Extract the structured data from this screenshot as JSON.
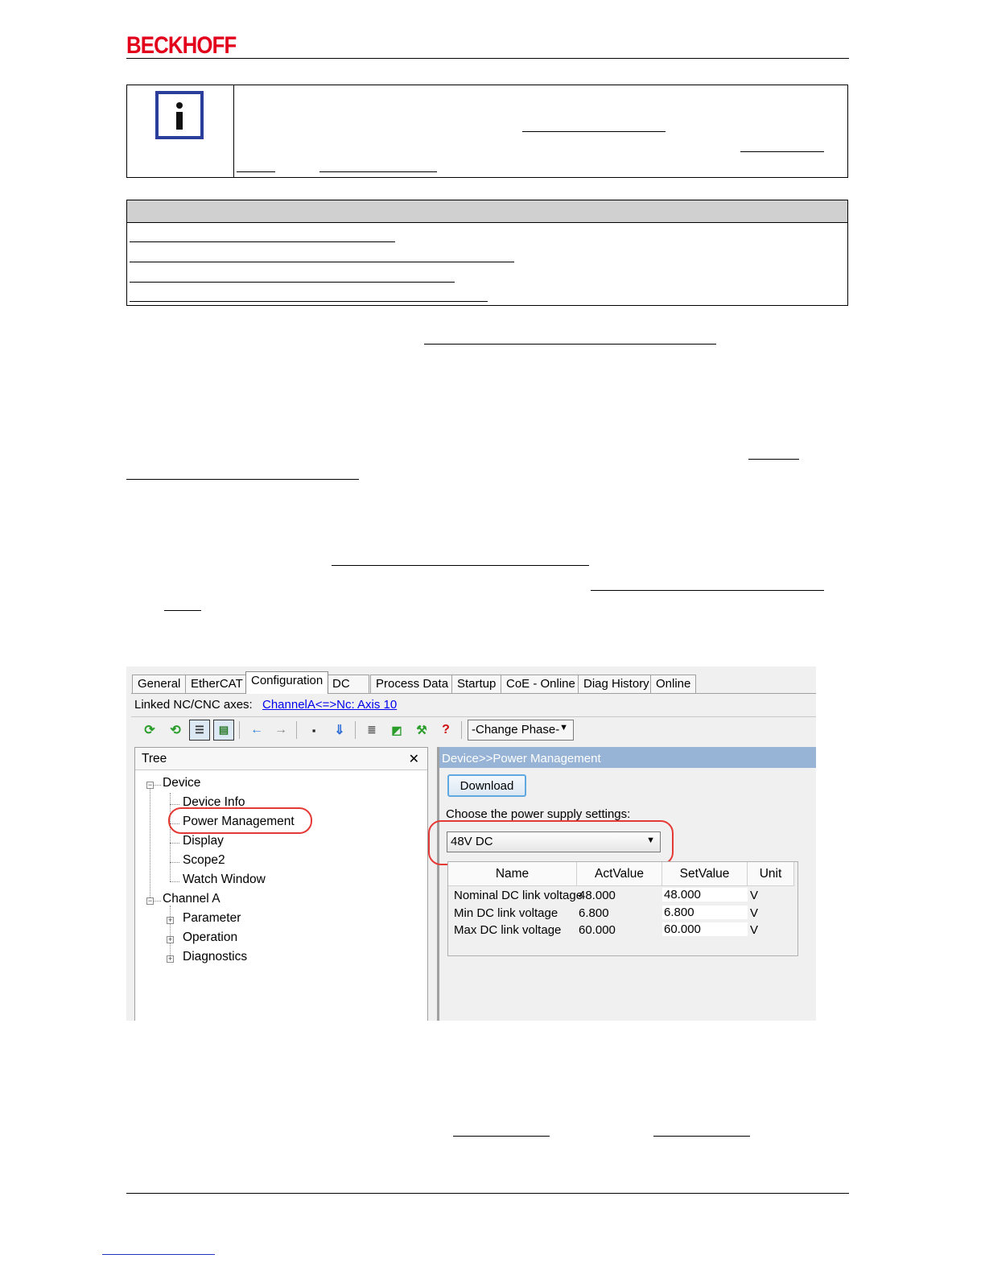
{
  "header": {
    "brand": "BECKHOFF"
  },
  "screenshot": {
    "tabs": [
      {
        "label": "General"
      },
      {
        "label": "EtherCAT"
      },
      {
        "label": "Configuration"
      },
      {
        "label": "DC"
      },
      {
        "label": "Process Data"
      },
      {
        "label": "Startup"
      },
      {
        "label": "CoE - Online"
      },
      {
        "label": "Diag History"
      },
      {
        "label": "Online"
      }
    ],
    "linked_axes": {
      "label": "Linked NC/CNC axes:",
      "link": "ChannelA<=>Nc: Axis 10"
    },
    "toolbar": {
      "phase_select": "-Change Phase-",
      "help_glyph": "?"
    },
    "tree": {
      "title": "Tree",
      "close_glyph": "✕",
      "items": [
        {
          "label": "Device"
        },
        {
          "label": "Device Info"
        },
        {
          "label": "Power Management"
        },
        {
          "label": "Display"
        },
        {
          "label": "Scope2"
        },
        {
          "label": "Watch Window"
        },
        {
          "label": "Channel A"
        },
        {
          "label": "Parameter"
        },
        {
          "label": "Operation"
        },
        {
          "label": "Diagnostics"
        }
      ]
    },
    "panel": {
      "title": "Device>>Power Management",
      "download_label": "Download",
      "choose_label": "Choose the power supply settings:",
      "supply_value": "48V DC",
      "columns": {
        "name": "Name",
        "act": "ActValue",
        "set": "SetValue",
        "unit": "Unit"
      },
      "rows": [
        {
          "name": "Nominal DC link voltage",
          "act": "48.000",
          "set": "48.000",
          "unit": "V"
        },
        {
          "name": "Min DC link voltage",
          "act": "6.800",
          "set": "6.800",
          "unit": "V"
        },
        {
          "name": "Max DC link voltage",
          "act": "60.000",
          "set": "60.000",
          "unit": "V"
        }
      ]
    }
  }
}
